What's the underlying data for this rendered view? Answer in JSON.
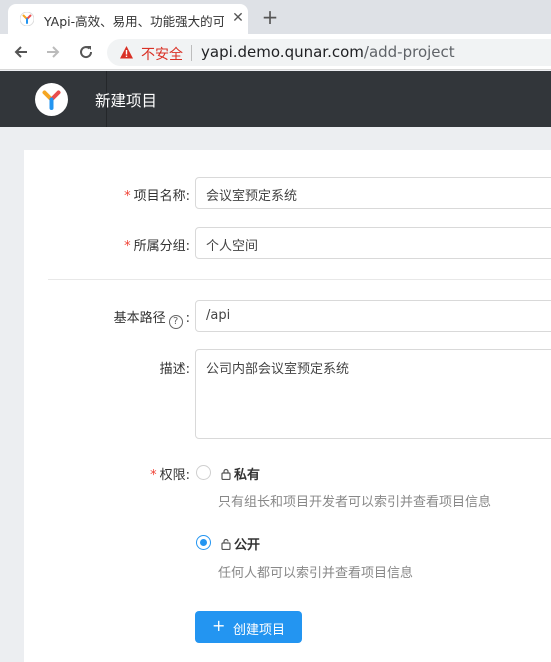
{
  "browser": {
    "tab_title": "YApi-高效、易用、功能强大的可",
    "close_glyph": "✕",
    "new_tab_glyph": "+",
    "security_text": "不安全",
    "url_host": "yapi.demo.qunar.com",
    "url_path": "/add-project"
  },
  "header": {
    "title": "新建项目"
  },
  "form": {
    "project_name": {
      "label": "项目名称:",
      "value": "会议室预定系统",
      "required": true
    },
    "group": {
      "label": "所属分组:",
      "value": "个人空间",
      "required": true
    },
    "base_path": {
      "label": "基本路径",
      "help": "?",
      "value": "/api"
    },
    "description": {
      "label": "描述:",
      "value": "公司内部会议室预定系统"
    },
    "permission": {
      "label": "权限:",
      "required": true,
      "options": [
        {
          "title": "私有",
          "desc": "只有组长和项目开发者可以索引并查看项目信息",
          "checked": false
        },
        {
          "title": "公开",
          "desc": "任何人都可以索引并查看项目信息",
          "checked": true
        }
      ]
    },
    "submit_label": "创建项目",
    "submit_icon": "+"
  },
  "colors": {
    "primary": "#2395f1",
    "header_bg": "#32363a",
    "required": "#f04134",
    "insecure": "#d93025"
  }
}
